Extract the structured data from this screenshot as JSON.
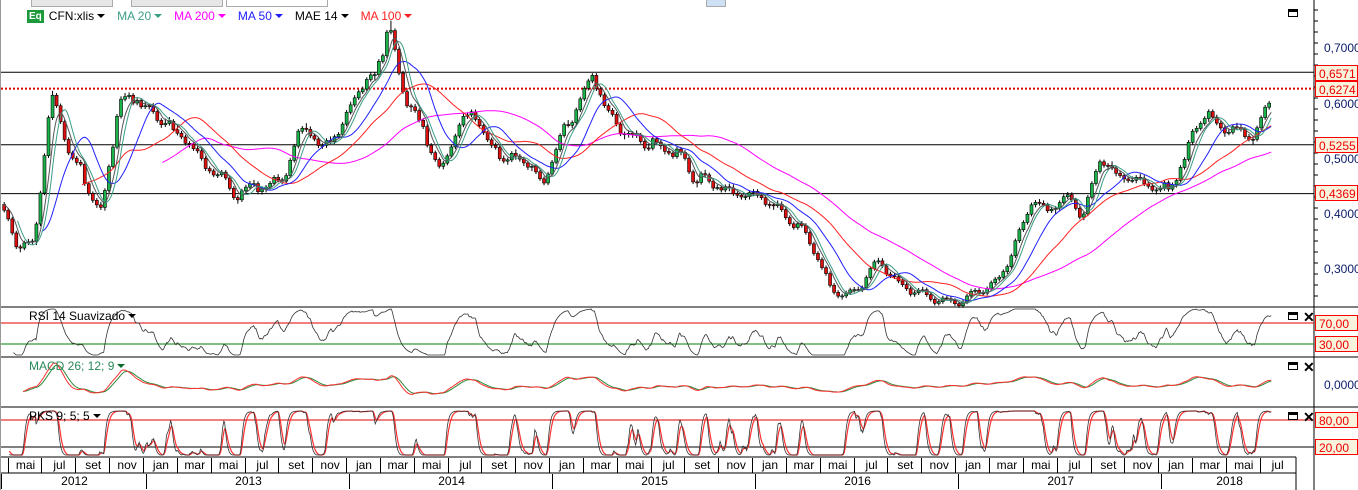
{
  "legend": {
    "symbol_badge": "Eq",
    "symbol": "CFN:xlis",
    "indicators": [
      {
        "label": "MA 20",
        "color": "#3a9e86"
      },
      {
        "label": "MA 200",
        "color": "#ff00ff"
      },
      {
        "label": "MA 50",
        "color": "#2020ff"
      },
      {
        "label": "MAE 14",
        "color": "#000000"
      },
      {
        "label": "MA 100",
        "color": "#ff2020"
      }
    ]
  },
  "colors": {
    "up": "#19b34a",
    "down": "#e01010",
    "level": "#000000",
    "level_active": "#e00000",
    "rsi_upper": "#e00000",
    "rsi_lower": "#008000"
  },
  "chart_data": [
    {
      "type": "candlestick",
      "title": "",
      "x_start": "2012-04",
      "x_unit": "month",
      "monthly_close": [
        0.42,
        0.34,
        0.34,
        0.62,
        0.52,
        0.46,
        0.4,
        0.6,
        0.6,
        0.58,
        0.56,
        0.54,
        0.5,
        0.46,
        0.42,
        0.45,
        0.45,
        0.48,
        0.56,
        0.52,
        0.55,
        0.63,
        0.63,
        0.73,
        0.6,
        0.57,
        0.47,
        0.55,
        0.58,
        0.52,
        0.5,
        0.5,
        0.45,
        0.53,
        0.6,
        0.64,
        0.57,
        0.55,
        0.54,
        0.53,
        0.51,
        0.47,
        0.46,
        0.44,
        0.44,
        0.43,
        0.41,
        0.38,
        0.34,
        0.27,
        0.25,
        0.27,
        0.32,
        0.27,
        0.26,
        0.25,
        0.24,
        0.24,
        0.26,
        0.28,
        0.34,
        0.42,
        0.41,
        0.43,
        0.4,
        0.5,
        0.46,
        0.46,
        0.46,
        0.45,
        0.5,
        0.58,
        0.57,
        0.55,
        0.53,
        0.61
      ],
      "ylim": [
        0.235,
        0.78
      ],
      "y_ticks": [
        "0,7000",
        "0,6000",
        "0,5000",
        "0,4000",
        "0,3000"
      ],
      "y_tick_values": [
        0.7,
        0.6,
        0.5,
        0.4,
        0.3
      ],
      "levels": [
        {
          "label": "0,6571",
          "value": 0.6571,
          "style": "solid"
        },
        {
          "label": "0,6274",
          "value": 0.6274,
          "style": "dotted-red"
        },
        {
          "label": "0,5255",
          "value": 0.5255,
          "style": "solid"
        },
        {
          "label": "0,4369",
          "value": 0.4369,
          "style": "solid"
        }
      ],
      "overlays": [
        "MA 20",
        "MA 200",
        "MA 50",
        "MAE 14",
        "MA 100"
      ]
    },
    {
      "type": "line",
      "title": "RSI 14 Suavizado",
      "levels": [
        {
          "label": "70,00",
          "value": 70
        },
        {
          "label": "30,00",
          "value": 30
        }
      ]
    },
    {
      "type": "line",
      "title": "MACD 26; 12; 9",
      "y_ticks": [
        "0,0000"
      ],
      "series": [
        "MACD",
        "Signal"
      ]
    },
    {
      "type": "line",
      "title": "PKS 9; 5; 5",
      "levels": [
        {
          "label": "80,00",
          "value": 80
        },
        {
          "label": "20,00",
          "value": 20
        }
      ]
    }
  ],
  "time_axis": {
    "months": [
      "mai",
      "jul",
      "set",
      "nov",
      "jan",
      "mar",
      "mai",
      "jul",
      "set",
      "nov",
      "jan",
      "mar",
      "mai",
      "jul",
      "set",
      "nov",
      "jan",
      "mar",
      "mai",
      "jul",
      "set",
      "nov",
      "jan",
      "mar",
      "mai",
      "jul",
      "set",
      "nov",
      "jan",
      "mar",
      "mai",
      "jul",
      "set",
      "nov",
      "jan",
      "mar",
      "mai",
      "jul"
    ],
    "years": [
      "2012",
      "2013",
      "2014",
      "2015",
      "2016",
      "2017",
      "2018"
    ]
  }
}
